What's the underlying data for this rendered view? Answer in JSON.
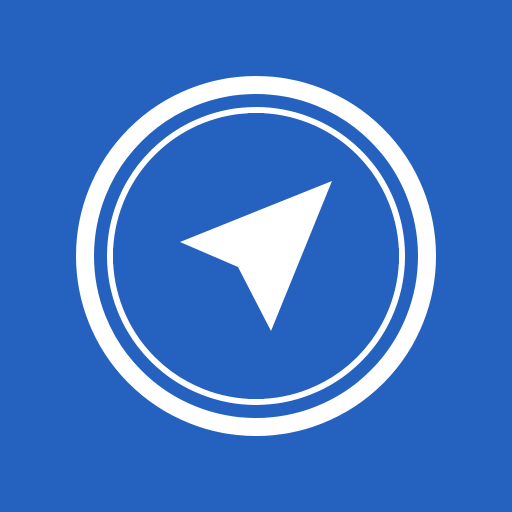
{
  "icon": {
    "name": "compass-icon",
    "background_color": "#2561BE",
    "foreground_color": "#FFFFFF",
    "needle": "navigation-arrow-icon",
    "cardinal_marks": [
      "north-mark",
      "east-mark",
      "south-mark",
      "west-mark"
    ]
  }
}
